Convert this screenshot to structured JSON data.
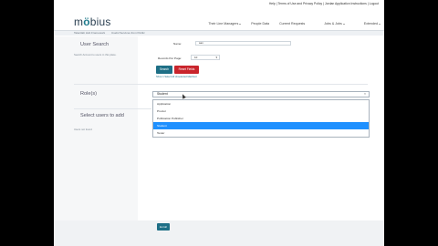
{
  "header": {
    "top_links": "Help | Terms of Use and Privacy Policy | Jordan Application Instructions | Logout",
    "logo_prefix": "m",
    "logo_o": "ö",
    "logo_suffix": "bius",
    "nav": [
      "Their Line Managers",
      "People Data",
      "Current Requests",
      "Jobs & Jobs",
      "Extended"
    ]
  },
  "breadcrumb": [
    "Talentlab Hub Framework",
    "Useful Services from Public"
  ],
  "user_search": {
    "title": "User Search",
    "subtitle": "Search Account to users in this place.",
    "name_label": "Name:",
    "name_value": "san",
    "records_label": "Records Per Page:",
    "records_value": "10",
    "search_button": "Search",
    "reset_button": "Reset Fields",
    "result_note": "Show 1 Select All Unselected Matched"
  },
  "roles": {
    "title": "Role(s)",
    "selected": "Student",
    "options": [
      "Application",
      "Proctor",
      "Publication Publisher",
      "Student",
      "Tester"
    ],
    "selected_index": 3
  },
  "select_users": {
    "title": "Select users to add",
    "note": "Users not found"
  },
  "footer": {
    "button": "Enroll"
  }
}
